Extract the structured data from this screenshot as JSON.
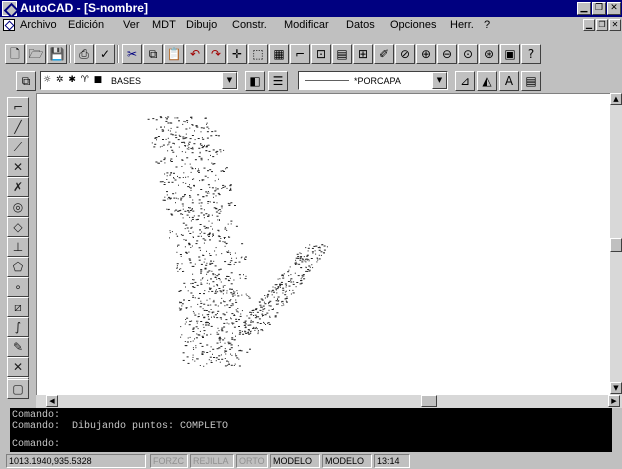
{
  "window": {
    "title": "AutoCAD - [S-nombre]"
  },
  "menu": {
    "items": [
      {
        "label": "Archivo"
      },
      {
        "label": "Edición"
      },
      {
        "label": "Ver"
      },
      {
        "label": "MDT"
      },
      {
        "label": "Dibujo"
      },
      {
        "label": "Constr."
      },
      {
        "label": "Modificar"
      },
      {
        "label": "Datos"
      },
      {
        "label": "Opciones"
      },
      {
        "label": "Herr."
      },
      {
        "label": "?"
      }
    ]
  },
  "properties": {
    "layer": "BASES",
    "linetype": "*PORCAPA"
  },
  "command_window": {
    "lines": [
      "Comando:",
      "Comando:  Dibujando puntos: COMPLETO",
      "Comando:"
    ]
  },
  "status_bar": {
    "coordinates": "1013.1940,935.5328",
    "modes": [
      {
        "label": "FORZC",
        "active": false
      },
      {
        "label": "REJILLA",
        "active": false
      },
      {
        "label": "ORTO",
        "active": false
      },
      {
        "label": "MODELO",
        "active": true
      },
      {
        "label": "MODELO",
        "active": true
      },
      {
        "label": "13:14",
        "active": true
      }
    ]
  },
  "colors": {
    "titlebar": "#000080",
    "face": "#c0c0c0",
    "drawing_background": "#ffffff",
    "command_background": "#000000",
    "command_text": "#c8c8c8",
    "points": "#202020"
  }
}
